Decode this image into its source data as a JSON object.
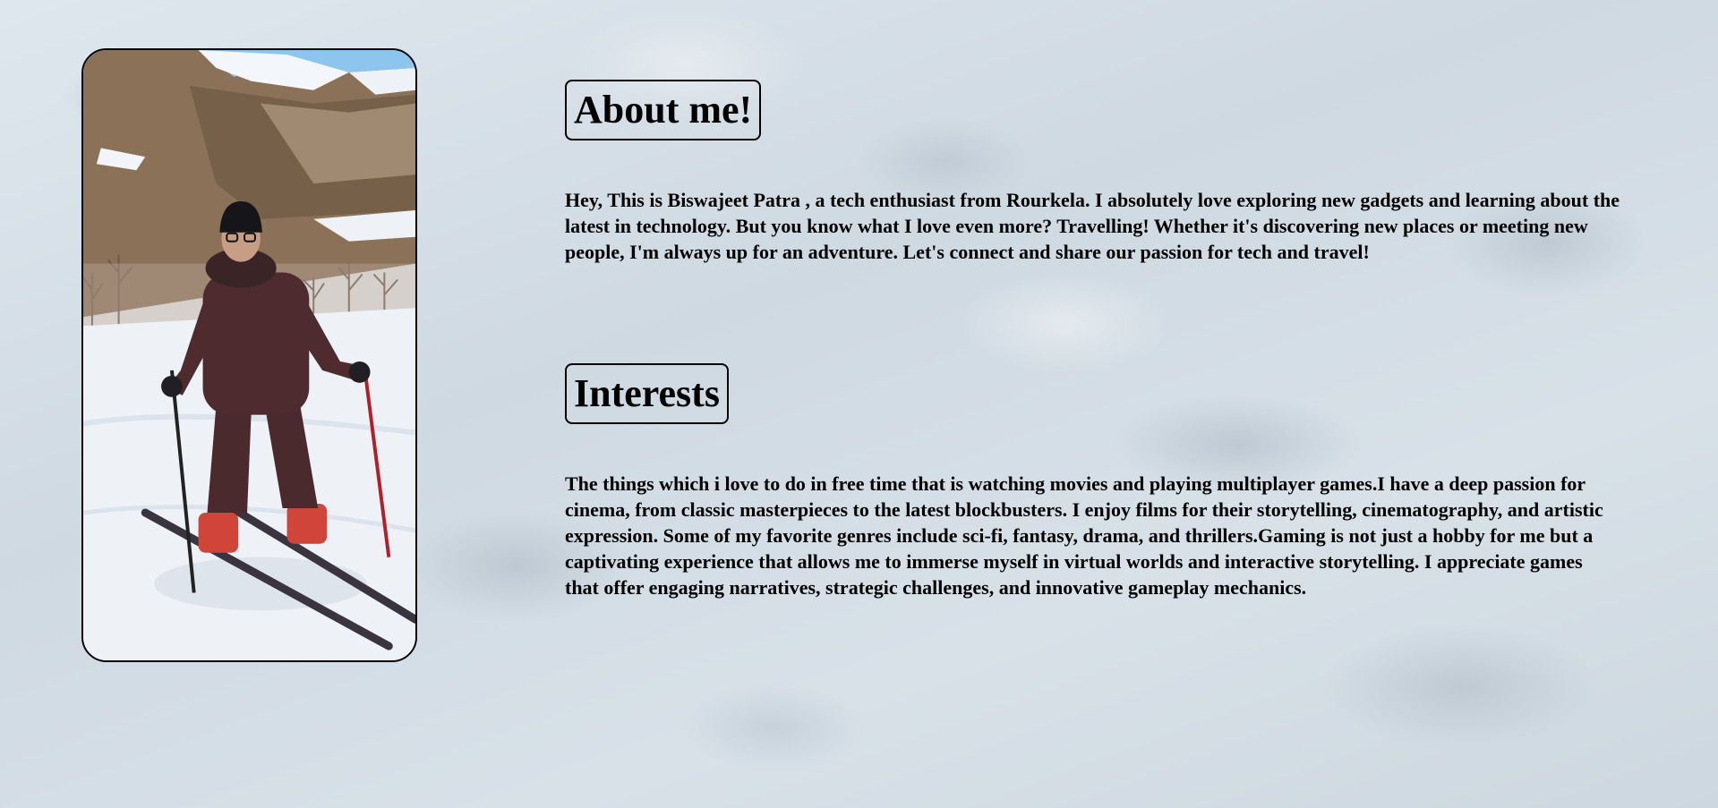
{
  "profile_photo": {
    "subject": "person skiing on snowy slope with mountains"
  },
  "about": {
    "heading": "About me!",
    "text": "Hey, This is Biswajeet Patra , a tech enthusiast from Rourkela. I absolutely love exploring new gadgets and learning about the latest in technology. But you know what I love even more? Travelling! Whether it's discovering new places or meeting new people, I'm always up for an adventure. Let's connect and share our passion for tech and travel!"
  },
  "interests": {
    "heading": "Interests",
    "text": "The things which i love to do in free time that is watching movies and playing multiplayer games.I have a deep passion for cinema, from classic masterpieces to the latest blockbusters. I enjoy films for their storytelling, cinematography, and artistic expression. Some of my favorite genres include sci-fi, fantasy, drama, and thrillers.Gaming is not just a hobby for me but a captivating experience that allows me to immerse myself in virtual worlds and interactive storytelling. I appreciate games that offer engaging narratives, strategic challenges, and innovative gameplay mechanics."
  },
  "colors": {
    "background": "#d3dde5",
    "text": "#000000"
  }
}
